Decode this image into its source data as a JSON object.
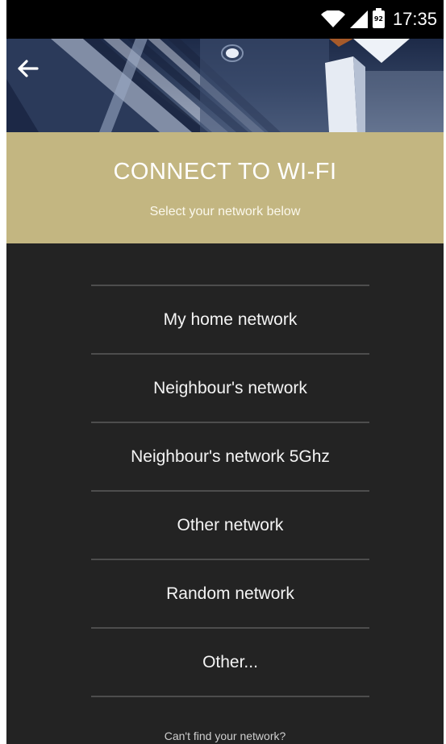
{
  "status_bar": {
    "time": "17:35",
    "battery_level": "92",
    "icons": [
      "wifi-icon",
      "cell-signal-icon",
      "battery-icon"
    ]
  },
  "header": {
    "back_icon": "arrow-left-icon"
  },
  "banner": {
    "title": "CONNECT TO WI-FI",
    "subtitle": "Select your network below",
    "background_color": "#c3b681"
  },
  "networks": [
    {
      "label": "My home network"
    },
    {
      "label": "Neighbour's network"
    },
    {
      "label": "Neighbour's network 5Ghz"
    },
    {
      "label": "Other network"
    },
    {
      "label": "Random network"
    },
    {
      "label": "Other..."
    }
  ],
  "footer": {
    "link_text": "Can't find your network?"
  },
  "colors": {
    "background": "#232323",
    "divider": "#4d4d4d",
    "text": "#f4f4f4"
  }
}
